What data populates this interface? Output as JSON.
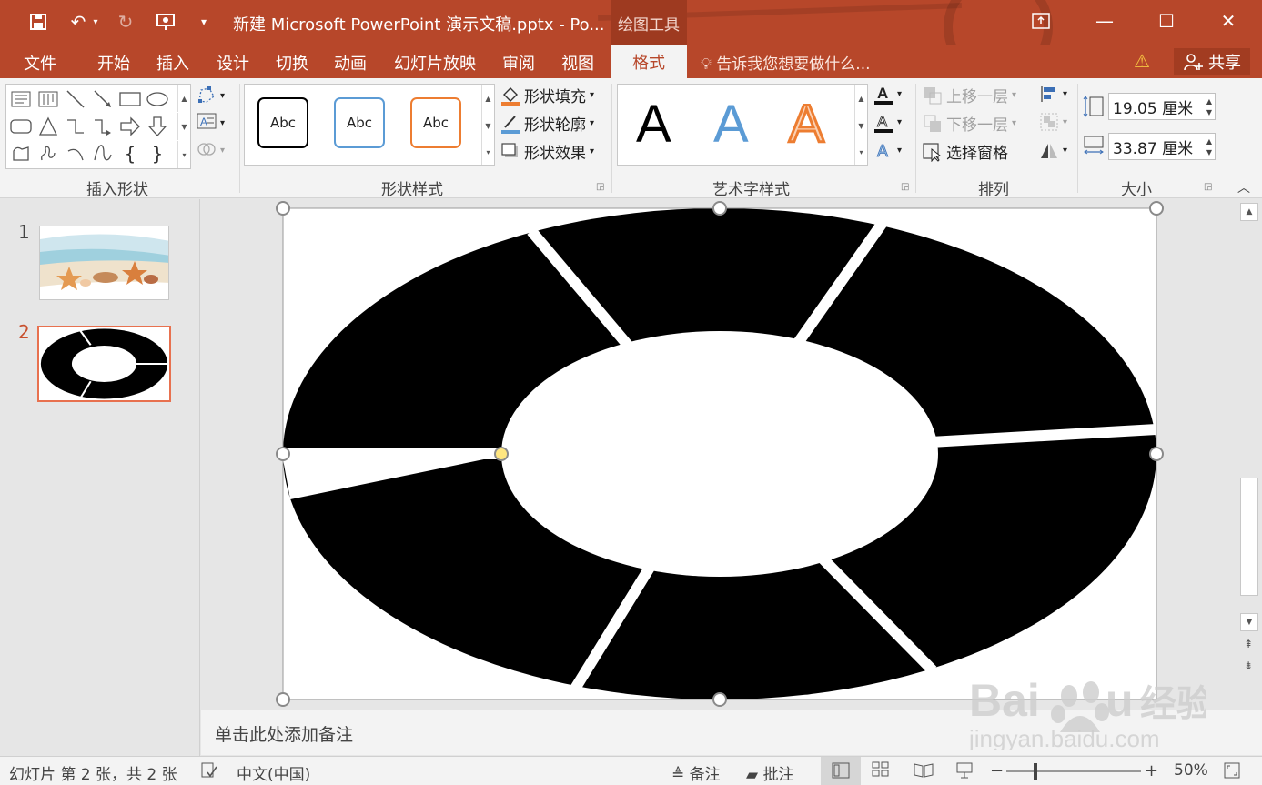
{
  "window": {
    "title": "新建 Microsoft PowerPoint 演示文稿.pptx - Po...",
    "contextual_tab_group": "绘图工具",
    "colors": {
      "accent": "#b7472a",
      "accent_dark": "#9e3a20",
      "selected_thumb": "#e8714f"
    }
  },
  "qat": {
    "icons": [
      "save-icon",
      "undo-icon",
      "redo-icon",
      "present-icon",
      "customize-icon"
    ]
  },
  "tabs": [
    "文件",
    "开始",
    "插入",
    "设计",
    "切换",
    "动画",
    "幻灯片放映",
    "审阅",
    "视图",
    "格式"
  ],
  "tellme": "告诉我您想要做什么...",
  "share": "共享",
  "ribbon": {
    "insert_shapes": {
      "label": "插入形状"
    },
    "shape_styles": {
      "label": "形状样式",
      "samples": [
        "Abc",
        "Abc",
        "Abc"
      ],
      "fill": "形状填充",
      "outline": "形状轮廓",
      "effects": "形状效果"
    },
    "wordart_styles": {
      "label": "艺术字样式",
      "samples": [
        "A",
        "A",
        "A"
      ]
    },
    "arrange": {
      "label": "排列",
      "bring_forward": "上移一层",
      "send_backward": "下移一层",
      "selection_pane": "选择窗格"
    },
    "size": {
      "label": "大小",
      "height": "19.05 厘米",
      "width": "33.87 厘米"
    }
  },
  "slides": [
    {
      "number": "1"
    },
    {
      "number": "2"
    }
  ],
  "notes_placeholder": "单击此处添加备注",
  "status": {
    "slide_info": "幻灯片 第 2 张，共 2 张",
    "language": "中文(中国)",
    "notes": "备注",
    "comments": "批注",
    "zoom": "50%"
  },
  "watermark": {
    "brand": "Baidu 经验",
    "url": "jingyan.baidu.com"
  }
}
